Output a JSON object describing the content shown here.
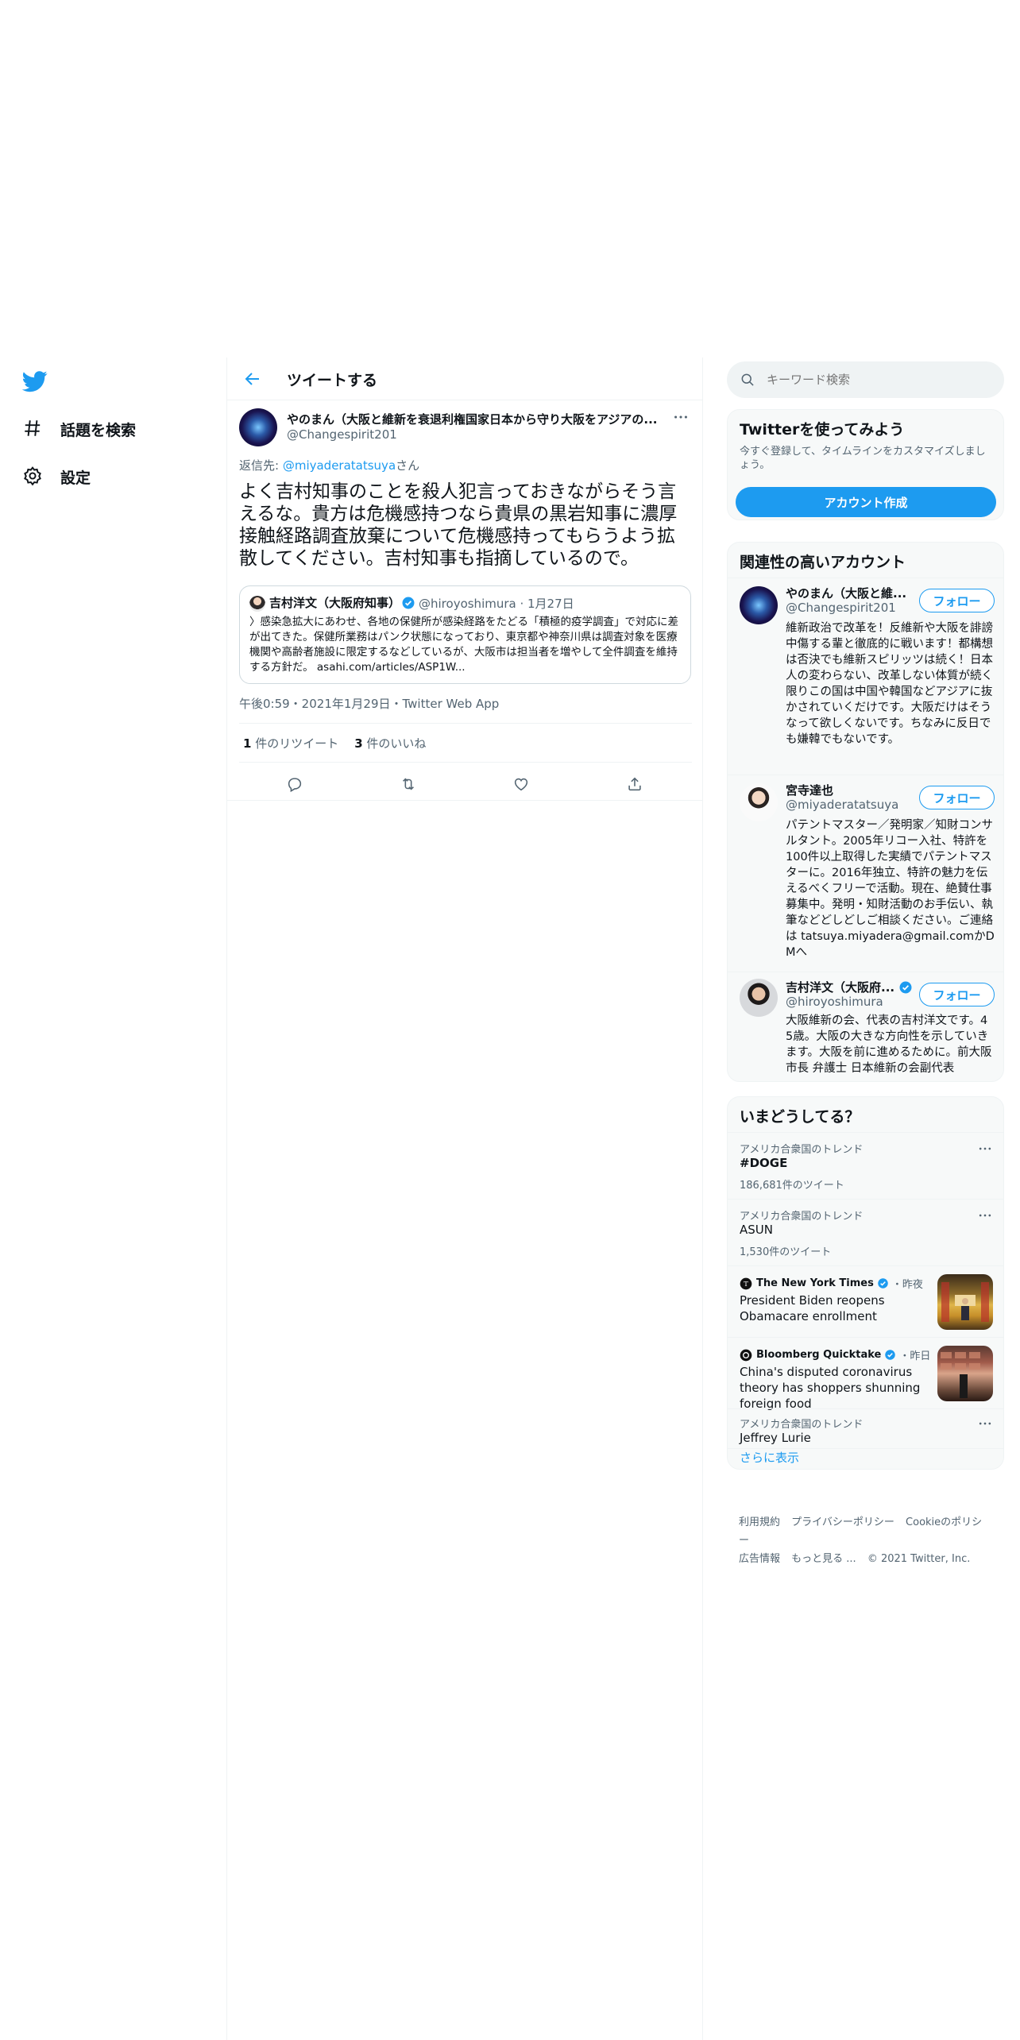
{
  "nav": {
    "explore": "話題を検索",
    "settings": "設定"
  },
  "header": {
    "title": "ツイートする"
  },
  "tweet": {
    "author_name": "やのまん（大阪と維新を衰退利権国家日本から守り大阪をアジアの...",
    "author_handle": "@Changespirit201",
    "reply_prefix": "返信先: ",
    "reply_to": "@miyaderatatsuya",
    "reply_suffix": "さん",
    "text": "よく吉村知事のことを殺人犯言っておきながらそう言えるな。貴方は危機感持つなら貴県の黒岩知事に濃厚接触経路調査放棄について危機感持ってもらうよう拡散してください。吉村知事も指摘しているので。",
    "timestamp": "午後0:59・2021年1月29日・Twitter Web App",
    "retweets_count": "1",
    "retweets_label": " 件のリツイート",
    "likes_count": "3",
    "likes_label": " 件のいいね"
  },
  "quote": {
    "name": "吉村洋文（大阪府知事）",
    "handle_date": "@hiroyoshimura · 1月27日",
    "text": "〉感染急拡大にあわせ、各地の保健所が感染経路をたどる「積極的疫学調査」で対応に差が出てきた。保健所業務はパンク状態になっており、東京都や神奈川県は調査対象を医療機関や高齢者施設に限定するなどしているが、大阪市は担当者を増やして全件調査を維持する方針だ。 asahi.com/articles/ASP1W..."
  },
  "search": {
    "placeholder": "キーワード検索"
  },
  "signup": {
    "title": "Twitterを使ってみよう",
    "subtitle": "今すぐ登録して、タイムラインをカスタマイズしましょう。",
    "button": "アカウント作成"
  },
  "related": {
    "title": "関連性の高いアカウント",
    "follow_label": "フォロー",
    "accounts": [
      {
        "name": "やのまん（大阪と維...",
        "handle": "@Changespirit201",
        "bio": "維新政治で改革を！反維新や大阪を誹謗中傷する輩と徹底的に戦います！都構想は否決でも維新スピリッツは続く！日本人の変わらない、改革しない体質が続く限りこの国は中国や韓国などアジアに抜かされていくだけです。大阪だけはそうなって欲しくないです。ちなみに反日でも嫌韓でもないです。"
      },
      {
        "name": "宮寺達也",
        "handle": "@miyaderatatsuya",
        "bio": "パテントマスター／発明家／知財コンサルタント。2005年リコー入社、特許を100件以上取得した実績でパテントマスターに。2016年独立、特許の魅力を伝えるべくフリーで活動。現在、絶賛仕事募集中。発明・知財活動のお手伝い、執筆などどしどしご相談ください。ご連絡は tatsuya.miyadera@gmail.comかDMへ"
      },
      {
        "name": "吉村洋文（大阪府...",
        "handle": "@hiroyoshimura",
        "bio": "大阪維新の会、代表の吉村洋文です。45歳。大阪の大きな方向性を示していきます。大阪を前に進めるために。前大阪市長 弁護士 日本維新の会副代表"
      }
    ]
  },
  "trends": {
    "title": "いまどうしてる？",
    "items": [
      {
        "context": "アメリカ合衆国のトレンド",
        "name": "#DOGE",
        "count": "186,681件のツイート"
      },
      {
        "context": "アメリカ合衆国のトレンド",
        "name": "ASUN",
        "count": "1,530件のツイート"
      }
    ],
    "news": [
      {
        "source": "The New York Times",
        "meta": "・昨夜",
        "title": "President Biden reopens Obamacare enrollment"
      },
      {
        "source": "Bloomberg Quicktake",
        "meta": "・昨日",
        "title": "China's disputed coronavirus theory has shoppers shunning foreign food"
      }
    ],
    "last": {
      "context": "アメリカ合衆国のトレンド",
      "name": "Jeffrey Lurie"
    },
    "show_more": "さらに表示"
  },
  "footer": {
    "terms": "利用規約",
    "privacy": "プライバシーポリシー",
    "cookie": "Cookieのポリシー",
    "ads": "広告情報",
    "more": "もっと見る ...",
    "copyright": "© 2021 Twitter, Inc."
  },
  "colors": {
    "accent": "#1d9bf0",
    "text": "#0f1419",
    "secondary": "#536471",
    "border": "#eff3f4"
  }
}
